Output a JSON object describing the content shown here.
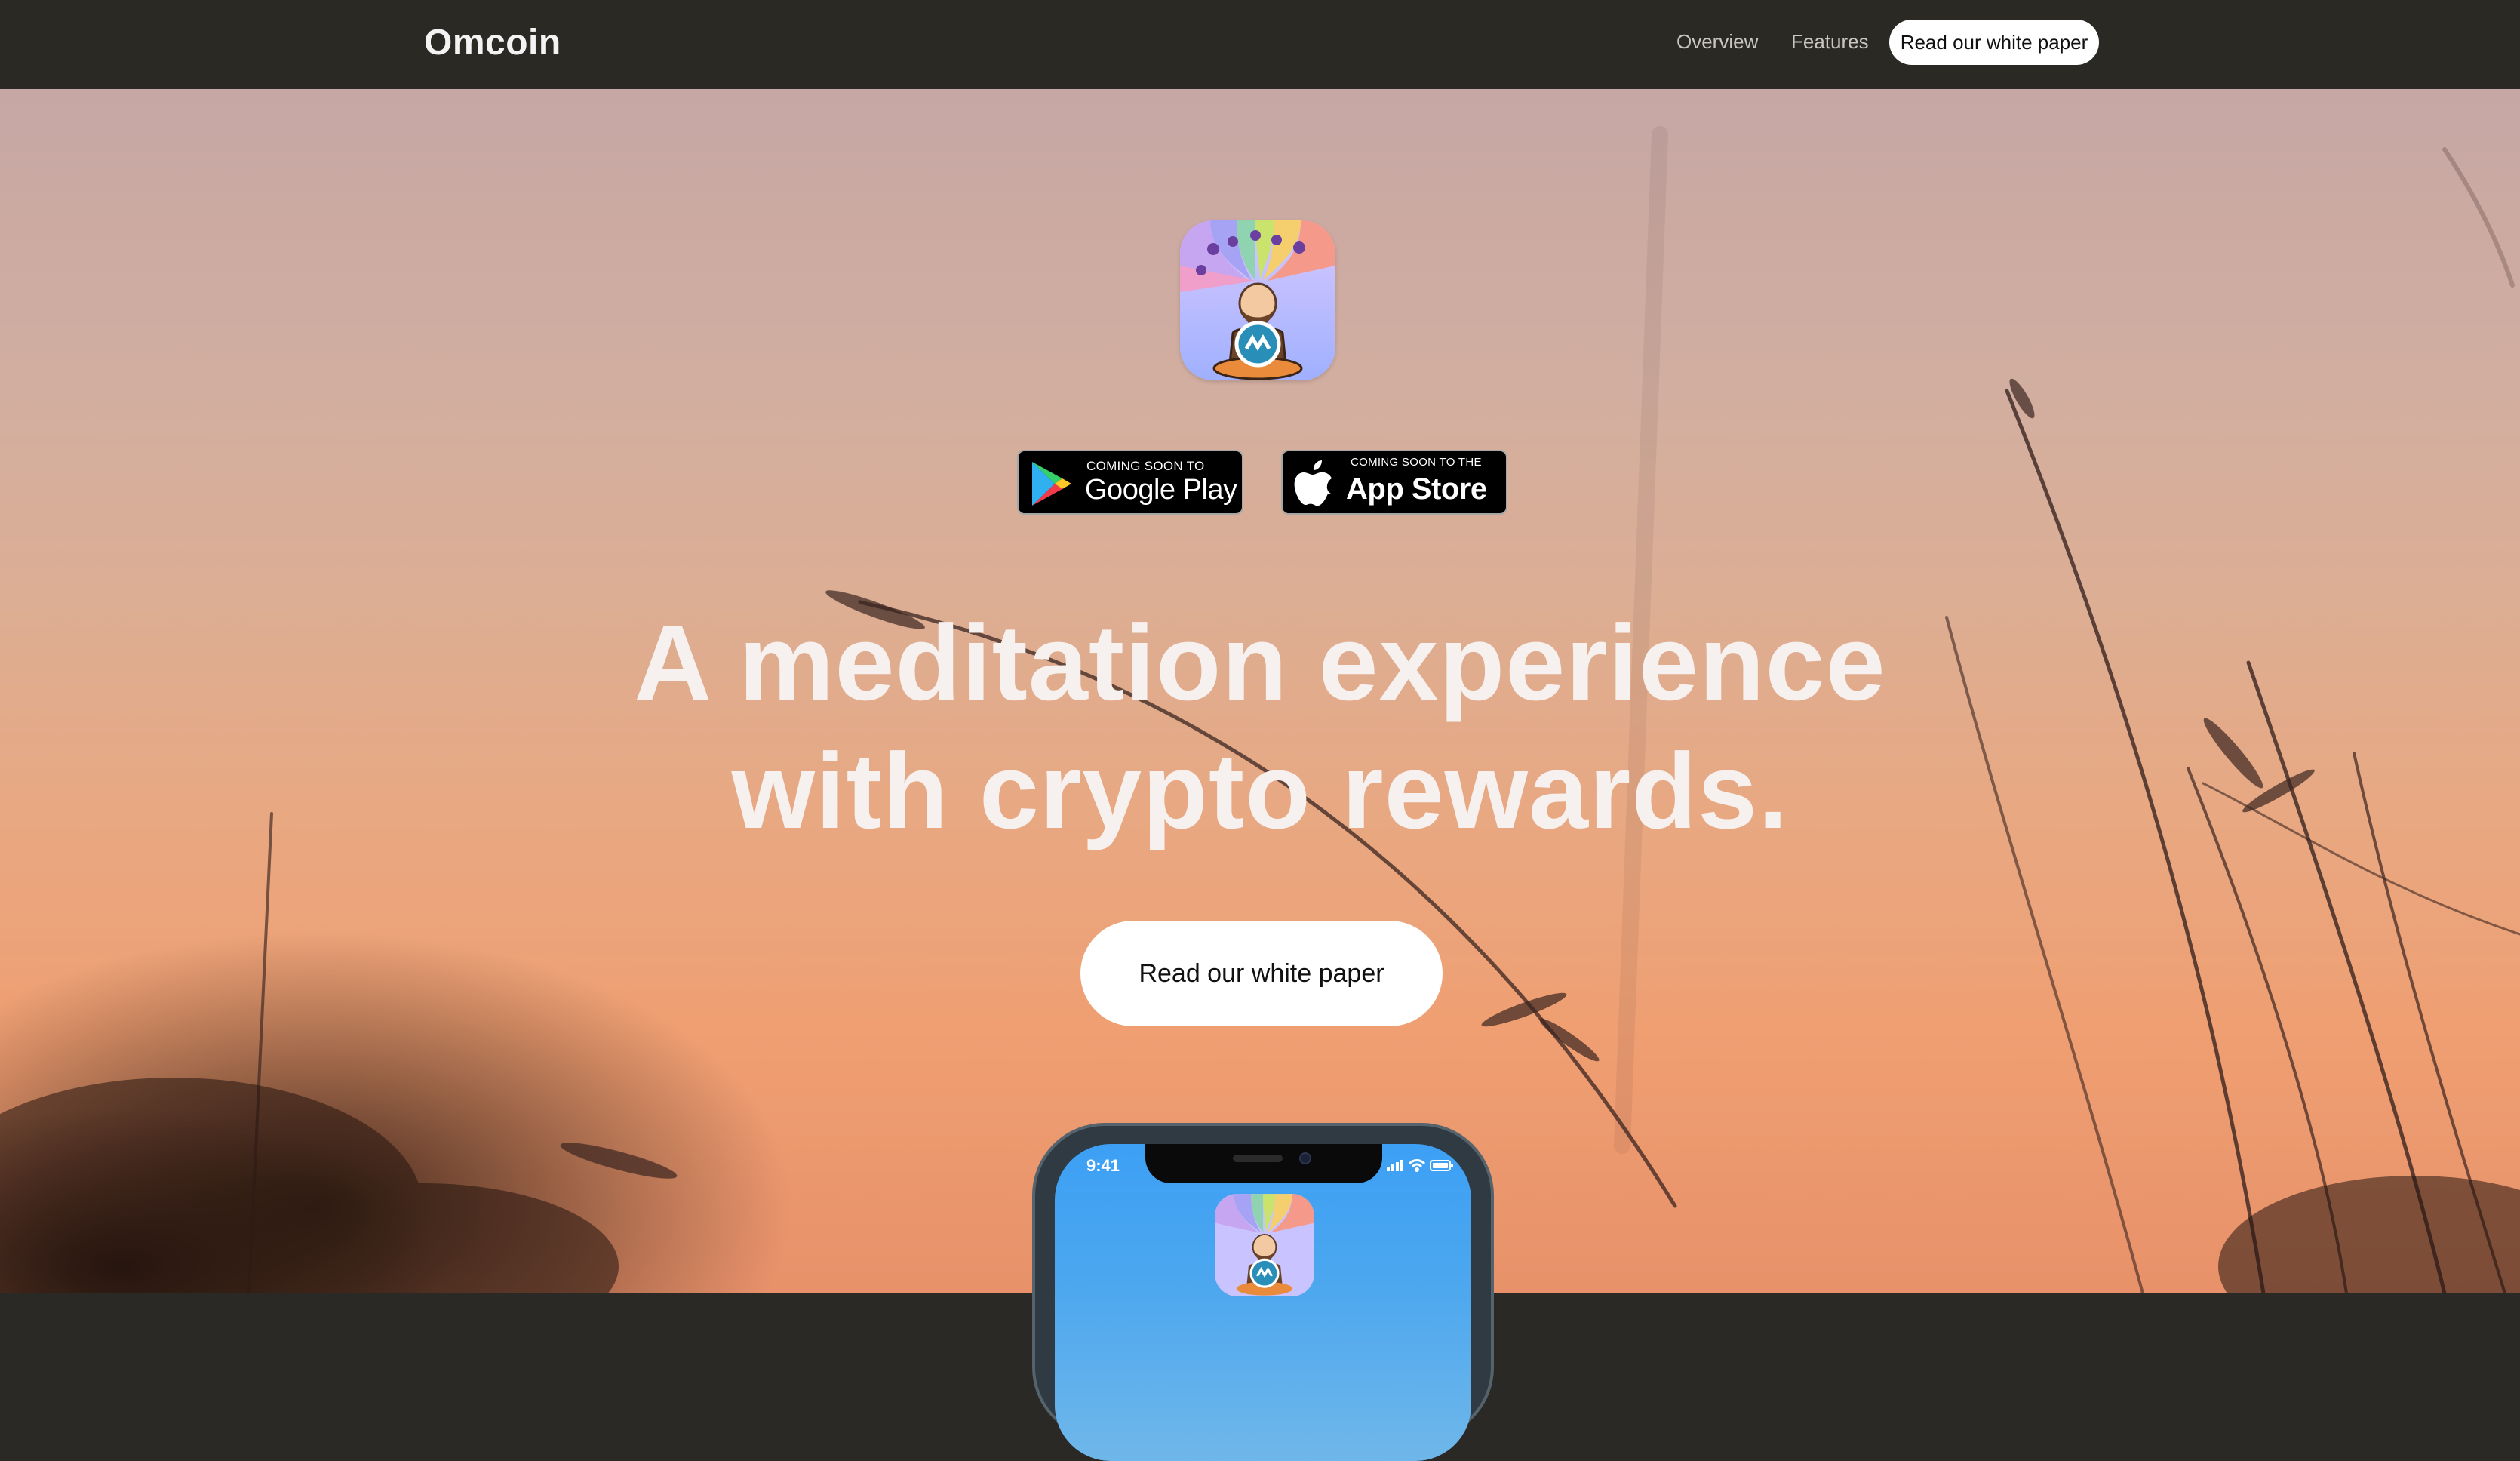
{
  "navbar": {
    "brand": "Omcoin",
    "links": [
      {
        "label": "Overview"
      },
      {
        "label": "Features"
      }
    ],
    "cta_label": "Read our white paper"
  },
  "hero": {
    "app_icon": "omcoin-app-icon",
    "badges": {
      "google": {
        "small": "COMING SOON TO",
        "big": "Google Play",
        "icon": "google-play-icon"
      },
      "apple": {
        "small": "COMING SOON TO THE",
        "big": "App Store",
        "icon": "apple-icon"
      }
    },
    "headline_line1": "A meditation experience",
    "headline_line2": "with crypto rewards.",
    "cta_label": "Read our white paper"
  },
  "phone": {
    "time": "9:41",
    "status_icons": [
      "signal-icon",
      "wifi-icon",
      "battery-icon"
    ],
    "app_icon": "omcoin-app-icon"
  },
  "colors": {
    "navbar_bg": "#2b2924",
    "headline": "#f6f0ee",
    "button_bg": "#ffffff"
  }
}
